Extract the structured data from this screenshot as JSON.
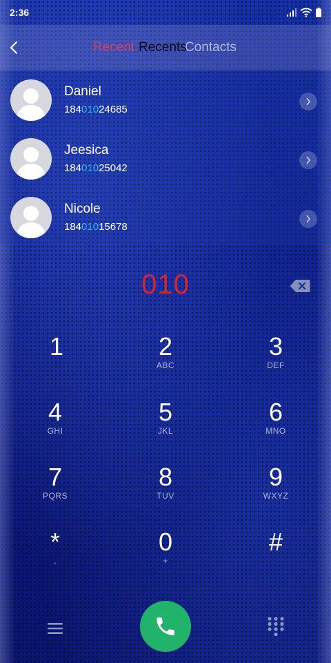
{
  "status_bar": {
    "time": "2:36"
  },
  "header": {
    "tabs": [
      {
        "label": "Recent"
      },
      {
        "label": "Recents"
      },
      {
        "label": "Contacts"
      }
    ]
  },
  "contacts": [
    {
      "name": "Daniel",
      "number_prefix": "184",
      "number_match": "010",
      "number_suffix": "24685"
    },
    {
      "name": "Jeesica",
      "number_prefix": "184",
      "number_match": "010",
      "number_suffix": "25042"
    },
    {
      "name": "Nicole",
      "number_prefix": "184",
      "number_match": "010",
      "number_suffix": "15678"
    }
  ],
  "dialer": {
    "number": "010"
  },
  "keypad": {
    "keys": [
      {
        "digit": "1",
        "letters": ""
      },
      {
        "digit": "2",
        "letters": "ABC"
      },
      {
        "digit": "3",
        "letters": "DEF"
      },
      {
        "digit": "4",
        "letters": "GHI"
      },
      {
        "digit": "5",
        "letters": "JKL"
      },
      {
        "digit": "6",
        "letters": "MNO"
      },
      {
        "digit": "7",
        "letters": "PQRS"
      },
      {
        "digit": "8",
        "letters": "TUV"
      },
      {
        "digit": "9",
        "letters": "WXYZ"
      },
      {
        "digit": "*",
        "letters": ","
      },
      {
        "digit": "0",
        "letters": "+"
      },
      {
        "digit": "#",
        "letters": ""
      }
    ]
  },
  "icons": {
    "back": "chevron-left-icon",
    "backspace": "backspace-icon",
    "call": "phone-icon",
    "menu": "menu-icon",
    "dialpad": "dialpad-icon",
    "wifi": "wifi-icon",
    "signal": "signal-icon",
    "battery": "battery-icon"
  },
  "colors": {
    "dialed_number": "#d8232e",
    "match_highlight": "#32b4f0",
    "call_button": "#22b36a"
  }
}
